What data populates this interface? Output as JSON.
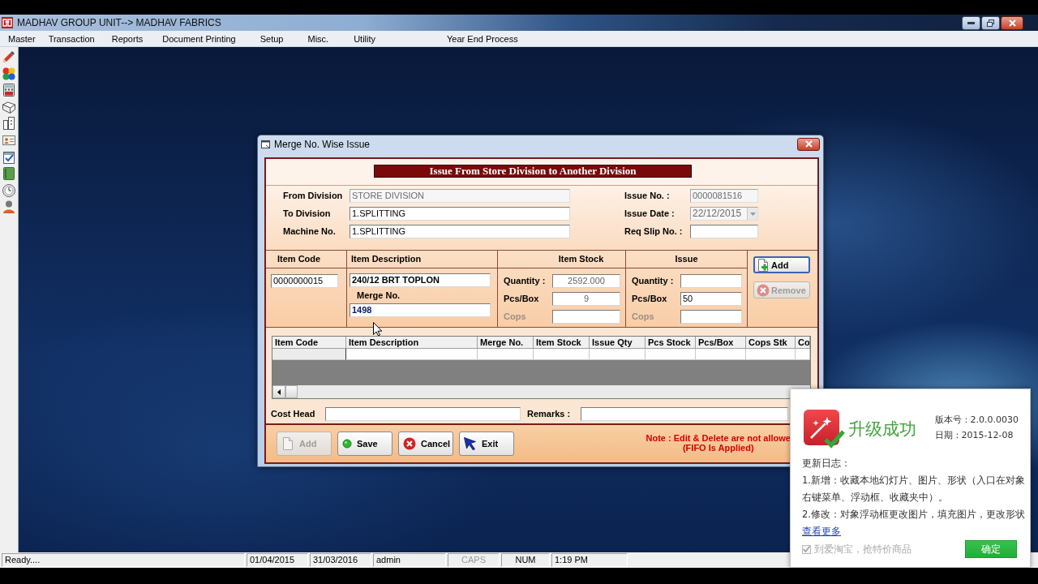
{
  "app_window": {
    "title": "MADHAV GROUP UNIT--> MADHAV FABRICS"
  },
  "menu": [
    "Master",
    "Transaction",
    "Reports",
    "Document Printing",
    "Setup",
    "Misc.",
    "Utility",
    "Year End Process"
  ],
  "dialog": {
    "title": "Merge No. Wise Issue",
    "heading": "Issue From Store Division to Another Division",
    "header_fields": [
      {
        "label": "From Division",
        "value": "STORE DIVISION",
        "disabled": true
      },
      {
        "label": "To Division",
        "value": "1.SPLITTING",
        "disabled": false
      },
      {
        "label": "Machine No.",
        "value": "1.SPLITTING",
        "disabled": false
      }
    ],
    "right_fields": [
      {
        "label": "Issue No. :",
        "value": "0000081516",
        "kind": "text",
        "disabled": true
      },
      {
        "label": "Issue Date :",
        "value": "22/12/2015",
        "kind": "dropdown",
        "disabled": true
      },
      {
        "label": "Req Slip No. :",
        "kind": "text",
        "disabled": false
      }
    ],
    "entry": {
      "columns": [
        "Item Code",
        "Item Description",
        "Item Stock",
        "Issue"
      ],
      "item_code": "0000000015",
      "item_description": "240/12 BRT TOPLON",
      "merge_label": "Merge No.",
      "merge_no": "1498",
      "stock_fields": [
        {
          "label": "Quantity :",
          "value": "2592.000",
          "disabled": false
        },
        {
          "label": "Pcs/Box",
          "value": "9",
          "disabled": false
        },
        {
          "label": "Cops",
          "disabled": true
        }
      ],
      "issue_fields": [
        {
          "label": "Quantity :",
          "disabled": false
        },
        {
          "label": "Pcs/Box",
          "value": "50",
          "disabled": false
        },
        {
          "label": "Cops",
          "disabled": true
        }
      ],
      "buttons": [
        {
          "label": "Add",
          "kind": "add",
          "disabled": false,
          "focused": true
        },
        {
          "label": "Remove",
          "kind": "remove",
          "disabled": true,
          "focused": false
        }
      ]
    },
    "grid": {
      "columns": [
        "Item Code",
        "Item Description",
        "Merge No.",
        "Item Stock",
        "Issue Qty",
        "Pcs Stock",
        "Pcs/Box",
        "Cops Stk",
        "Co"
      ]
    },
    "bottom_fields": [
      {
        "label": "Cost Head"
      },
      {
        "label": "Remarks  :"
      }
    ],
    "actions": [
      {
        "label": "Add",
        "kind": "add",
        "disabled": true
      },
      {
        "label": "Save",
        "kind": "save",
        "disabled": false
      },
      {
        "label": "Cancel",
        "kind": "cancel",
        "disabled": false
      },
      {
        "label": "Exit",
        "kind": "exit",
        "disabled": false
      }
    ],
    "note": [
      "Note : Edit & Delete are not allowe",
      "(FIFO Is Applied)"
    ]
  },
  "popup": {
    "title": "升级成功",
    "version": "版本号：2.0.0.0030",
    "date": "日期：2015-12-08",
    "log_title": "更新日志：",
    "log_items": [
      "1.新增：收藏本地幻灯片、图片、形状（入口在对象右键菜单、浮动框、收藏夹中）。",
      "2.修改：对象浮动框更改图片，填充图片，更改形状"
    ],
    "more_link": "查看更多",
    "checkbox": {
      "label": "到爱淘宝，抢特价商品",
      "checked": true,
      "disabled": true
    },
    "button": "确定"
  },
  "status_bar": [
    {
      "text": "Ready....",
      "kind": "text"
    },
    {
      "text": "01/04/2015",
      "kind": "text"
    },
    {
      "text": "31/03/2016",
      "kind": "text"
    },
    {
      "text": "admin",
      "kind": "text"
    },
    {
      "text": "CAPS",
      "kind": "indicator",
      "on": false
    },
    {
      "text": "NUM",
      "kind": "indicator",
      "on": true
    },
    {
      "text": "1:19 PM",
      "kind": "text"
    }
  ]
}
